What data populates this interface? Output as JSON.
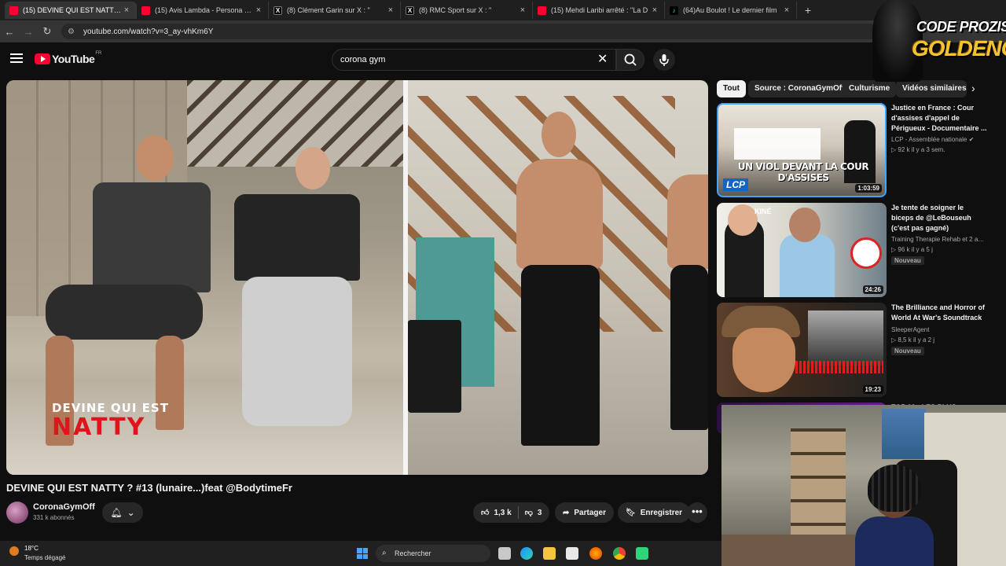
{
  "browser": {
    "tabs": [
      {
        "title": "(15) DEVINE QUI EST NATTY ?",
        "favicon": "youtube-icon"
      },
      {
        "title": "(15) Avis Lambda - Persona 5 R",
        "favicon": "youtube-icon"
      },
      {
        "title": "(8) Clément Garin sur X : \"",
        "favicon": "x-icon"
      },
      {
        "title": "(8) RMC Sport sur X : \"",
        "favicon": "x-icon"
      },
      {
        "title": "(15) Mehdi Laribi arrêté : \"La D",
        "favicon": "youtube-icon"
      },
      {
        "title": "(64)Au Boulot ! Le dernier film",
        "favicon": "tiktok-icon"
      }
    ],
    "new_tab_label": "+",
    "url": "youtube.com/watch?v=3_ay-vhKm6Y"
  },
  "youtube": {
    "logo_text": "YouTube",
    "country_code": "FR",
    "search_query": "corona gym",
    "clear_label": "✕"
  },
  "video": {
    "overlay_line1": "DEVINE QUI EST",
    "overlay_line2": "NATTY",
    "title": "DEVINE QUI EST NATTY ? #13 (lunaire...)feat @BodytimeFr",
    "channel": "CoronaGymOff",
    "subscribers": "331 k abonnés",
    "likes": "1,3 k",
    "dislikes": "3",
    "share_label": "Partager",
    "save_label": "Enregistrer",
    "more_label": "•••"
  },
  "chips": [
    "Tout",
    "Source : CoronaGymOff",
    "Culturisme",
    "Vidéos similaires"
  ],
  "recommendations": [
    {
      "title": "Justice en France : Cour d'assises d'appel de Périgueux - Documentaire ...",
      "channel": "LCP - Assemblée nationale",
      "verified": "✔",
      "stats": "▷ 92 k   il y a 3 sem.",
      "duration": "1:03:59",
      "thumb_caption": "UN VIOL DEVANT LA COUR D'ASSISES",
      "thumb_logo": "LCP"
    },
    {
      "title": "Je tente de soigner le biceps de @LeBouseuh (c'est pas gagné)",
      "channel": "Training Therapie Rehab et 2 autr...",
      "stats": "▷ 96 k   il y a 5 j",
      "badge": "Nouveau",
      "duration": "24:26",
      "thumb_caption": "KINÉ"
    },
    {
      "title": "The Brilliance and Horror of World At War's Soundtrack",
      "channel": "SleeperAgent",
      "stats": "▷ 8,5 k   il y a 2 j",
      "badge": "Nouveau",
      "duration": "19:23"
    },
    {
      "title": "TOP 10 : LES PLUS"
    }
  ],
  "overlay_brand": {
    "line1": "CODE PROZIS",
    "line2": "GOLDENG"
  },
  "taskbar": {
    "temperature": "18°C",
    "weather": "Temps dégagé",
    "search_label": "Rechercher",
    "search_icon": "magnifier-icon"
  },
  "colors": {
    "youtube_red": "#ff0033",
    "bg": "#0f0f0f",
    "surface": "#272727",
    "natty_red": "#e0141c",
    "brand_gold": "#f2c230"
  }
}
